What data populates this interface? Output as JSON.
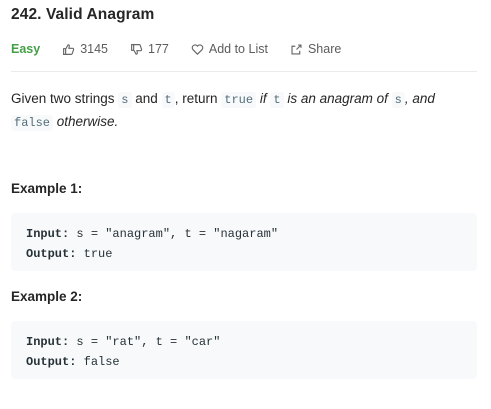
{
  "problem": {
    "title": "242. Valid Anagram",
    "difficulty": "Easy",
    "likes": "3145",
    "dislikes": "177",
    "add_to_list_label": "Add to List",
    "share_label": "Share"
  },
  "description": {
    "part1": "Given two strings ",
    "code_s": "s",
    "part2": " and ",
    "code_t": "t",
    "part3": ", return ",
    "code_true": "true",
    "part4": " ",
    "em_if": "if",
    "part5": " ",
    "code_t2": "t",
    "part6": " ",
    "em_anagram": "is an anagram of",
    "part7": " ",
    "code_s2": "s",
    "part8": ", and",
    "part9": " ",
    "code_false": "false",
    "part10": " ",
    "em_otherwise": "otherwise."
  },
  "examples": [
    {
      "title": "Example 1:",
      "input_label": "Input:",
      "input_value": " s = \"anagram\", t = \"nagaram\"",
      "output_label": "Output:",
      "output_value": " true"
    },
    {
      "title": "Example 2:",
      "input_label": "Input:",
      "input_value": " s = \"rat\", t = \"car\"",
      "output_label": "Output:",
      "output_value": " false"
    }
  ],
  "colors": {
    "easy": "#43a047",
    "code_bg": "#f7f9fa"
  },
  "icons": [
    "thumbs-up-icon",
    "thumbs-down-icon",
    "heart-icon",
    "share-icon"
  ]
}
